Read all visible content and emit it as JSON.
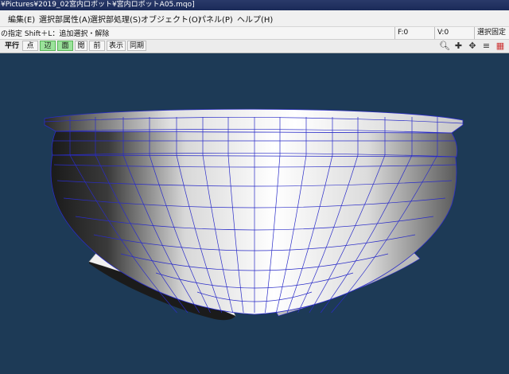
{
  "window": {
    "title": "¥Pictures¥2019_02宮内ロボット¥宮内ロボットA05.mqo]"
  },
  "menu": {
    "items": [
      "編集(E)",
      "選択部属性(A)",
      "選択部処理(S)",
      "オブジェクト(O)",
      "パネル(P)",
      "ヘルプ(H)"
    ]
  },
  "status": {
    "hint": "の指定 Shift＋L：追加選択・解除",
    "faces": "F:0",
    "verts": "V:0",
    "right": "選択固定"
  },
  "toolbar": {
    "buttons": [
      "平行",
      "点",
      "辺",
      "面",
      "閲",
      "前",
      "表示",
      "同期"
    ],
    "active": [
      "辺",
      "面"
    ],
    "tools": [
      "zoom-icon",
      "move-icon",
      "rotate-icon",
      "menu-icon",
      "panel-icon"
    ]
  },
  "colors": {
    "background": "#1d3a56",
    "wire": "#2a2cc8",
    "active_button": "#9be39b"
  }
}
